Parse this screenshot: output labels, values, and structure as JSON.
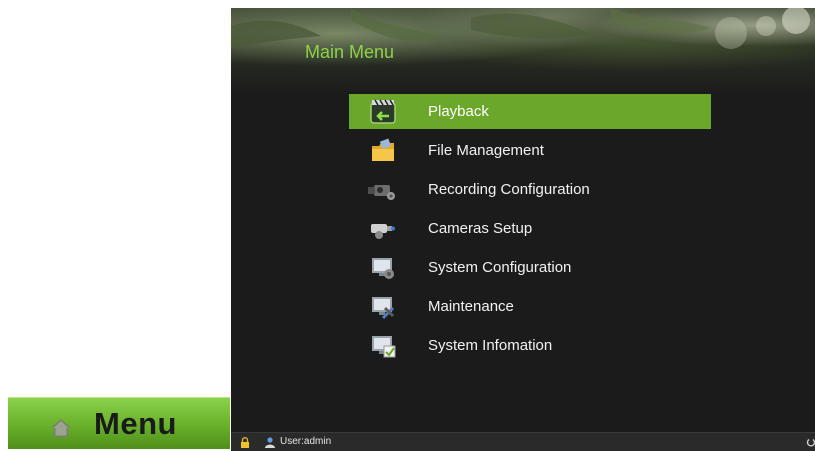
{
  "menu_button": {
    "label": "Menu",
    "icon": "home-icon"
  },
  "window": {
    "title": "Main Menu"
  },
  "menu_items": [
    {
      "label": "Playback",
      "icon": "playback-icon",
      "selected": true
    },
    {
      "label": "File Management",
      "icon": "folder-icon",
      "selected": false
    },
    {
      "label": "Recording Configuration",
      "icon": "video-camera-icon",
      "selected": false
    },
    {
      "label": "Cameras Setup",
      "icon": "security-camera-icon",
      "selected": false
    },
    {
      "label": "System Configuration",
      "icon": "monitor-gear-icon",
      "selected": false
    },
    {
      "label": "Maintenance",
      "icon": "monitor-tools-icon",
      "selected": false
    },
    {
      "label": "System Infomation",
      "icon": "monitor-info-icon",
      "selected": false
    }
  ],
  "statusbar": {
    "user_text": "User:admin"
  },
  "colors": {
    "accent_green": "#6aa72a",
    "title_green": "#8fd14a",
    "background": "#1b1b1b"
  }
}
